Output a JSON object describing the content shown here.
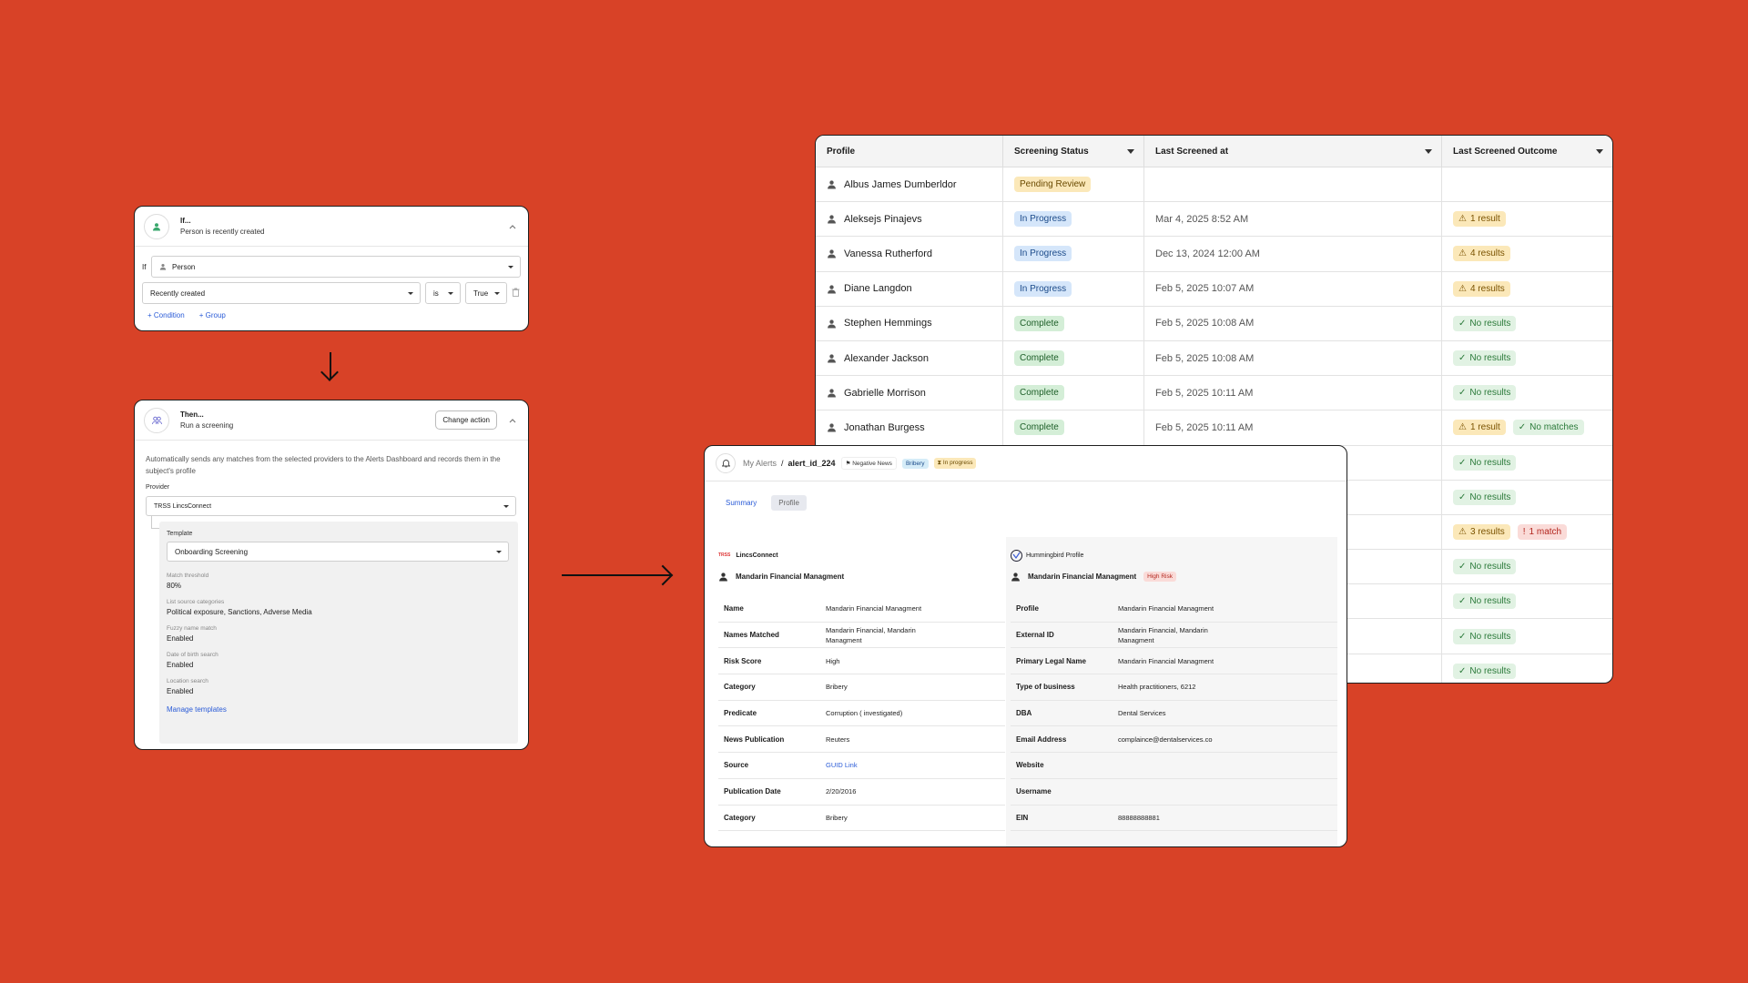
{
  "if_card": {
    "title": "If...",
    "subtitle": "Person is recently created",
    "if_label": "If",
    "subject_select": "Person",
    "condition_field": "Recently created",
    "operator": "is",
    "value": "True",
    "add_condition": "Condition",
    "add_group": "Group"
  },
  "then_card": {
    "title": "Then...",
    "subtitle": "Run a screening",
    "change_action": "Change action",
    "description": "Automatically sends any matches from the selected providers to the Alerts Dashboard and records them in the subject's profile",
    "provider_label": "Provider",
    "provider_value": "TRSS LincsConnect",
    "template_label": "Template",
    "template_value": "Onboarding Screening",
    "settings": [
      {
        "label": "Match threshold",
        "value": "80%"
      },
      {
        "label": "List source categories",
        "value": "Political exposure, Sanctions, Adverse Media"
      },
      {
        "label": "Fuzzy name match",
        "value": "Enabled"
      },
      {
        "label": "Date of birth search",
        "value": "Enabled"
      },
      {
        "label": "Location search",
        "value": "Enabled"
      }
    ],
    "manage_templates": "Manage templates"
  },
  "table": {
    "headers": [
      "Profile",
      "Screening Status",
      "Last Screened at",
      "Last Screened Outcome"
    ],
    "rows": [
      {
        "name": "Albus James Dumberldor",
        "status": "Pending Review",
        "date": "",
        "outcomes": []
      },
      {
        "name": "Aleksejs Pinajevs",
        "status": "In Progress",
        "date": "Mar 4, 2025 8:52 AM",
        "outcomes": [
          {
            "kind": "warn",
            "text": "1 result"
          }
        ]
      },
      {
        "name": "Vanessa Rutherford",
        "status": "In Progress",
        "date": "Dec 13, 2024 12:00 AM",
        "outcomes": [
          {
            "kind": "warn",
            "text": "4 results"
          }
        ]
      },
      {
        "name": "Diane Langdon",
        "status": "In Progress",
        "date": "Feb 5, 2025 10:07 AM",
        "outcomes": [
          {
            "kind": "warn",
            "text": "4 results"
          }
        ]
      },
      {
        "name": "Stephen Hemmings",
        "status": "Complete",
        "date": "Feb 5, 2025 10:08 AM",
        "outcomes": [
          {
            "kind": "ok",
            "text": "No results"
          }
        ]
      },
      {
        "name": "Alexander Jackson",
        "status": "Complete",
        "date": "Feb 5, 2025 10:08 AM",
        "outcomes": [
          {
            "kind": "ok",
            "text": "No results"
          }
        ]
      },
      {
        "name": "Gabrielle Morrison",
        "status": "Complete",
        "date": "Feb 5, 2025 10:11 AM",
        "outcomes": [
          {
            "kind": "ok",
            "text": "No results"
          }
        ]
      },
      {
        "name": "Jonathan Burgess",
        "status": "Complete",
        "date": "Feb 5, 2025 10:11 AM",
        "outcomes": [
          {
            "kind": "warn",
            "text": "1 result"
          },
          {
            "kind": "ok",
            "text": "No matches"
          }
        ]
      },
      {
        "name": "",
        "status": "",
        "date": "",
        "outcomes": [
          {
            "kind": "ok",
            "text": "No results"
          }
        ]
      },
      {
        "name": "",
        "status": "",
        "date": "",
        "outcomes": [
          {
            "kind": "ok",
            "text": "No results"
          }
        ]
      },
      {
        "name": "",
        "status": "",
        "date": "",
        "outcomes": [
          {
            "kind": "warn",
            "text": "3 results"
          },
          {
            "kind": "bad",
            "text": "1 match"
          }
        ]
      },
      {
        "name": "",
        "status": "",
        "date": "",
        "outcomes": [
          {
            "kind": "ok",
            "text": "No results"
          }
        ]
      },
      {
        "name": "",
        "status": "",
        "date": "",
        "outcomes": [
          {
            "kind": "ok",
            "text": "No results"
          }
        ]
      },
      {
        "name": "",
        "status": "",
        "date": "",
        "outcomes": [
          {
            "kind": "ok",
            "text": "No results"
          }
        ]
      },
      {
        "name": "",
        "status": "",
        "date": "",
        "outcomes": [
          {
            "kind": "ok",
            "text": "No results"
          }
        ]
      }
    ]
  },
  "alert": {
    "breadcrumb_root": "My Alerts",
    "breadcrumb_sep": "/",
    "alert_id": "alert_id_224",
    "tags": [
      "Negative News",
      "Bribery",
      "In progress"
    ],
    "tabs": [
      "Summary",
      "Profile"
    ],
    "left": {
      "provider": "LincsConnect",
      "provider_prefix": "TRSS",
      "entity": "Mandarin Financial Managment",
      "fields": [
        {
          "k": "Name",
          "v": "Mandarin Financial Managment"
        },
        {
          "k": "Names Matched",
          "v": "Mandarin Financial, Mandarin Managment"
        },
        {
          "k": "Risk Score",
          "v": "High"
        },
        {
          "k": "Category",
          "v": "Bribery"
        },
        {
          "k": "Predicate",
          "v": "Corruption ( investigated)"
        },
        {
          "k": "News Publication",
          "v": "Reuters"
        },
        {
          "k": "Source",
          "v": "GUID Link"
        },
        {
          "k": "Publication Date",
          "v": "2/20/2016"
        },
        {
          "k": "Category",
          "v": "Bribery"
        }
      ]
    },
    "right": {
      "provider": "Hummingbird Profile",
      "entity": "Mandarin Financial Managment",
      "risk_badge": "High Risk",
      "fields": [
        {
          "k": "Profile",
          "v": "Mandarin Financial Managment"
        },
        {
          "k": "External ID",
          "v": "Mandarin Financial, Mandarin Managment"
        },
        {
          "k": "Primary Legal Name",
          "v": "Mandarin Financial Managment"
        },
        {
          "k": "Type of business",
          "v": "Health practitioners,  6212"
        },
        {
          "k": "DBA",
          "v": "Dental Services"
        },
        {
          "k": "Email Address",
          "v": "complaince@dentalservices.co"
        },
        {
          "k": "Website",
          "v": ""
        },
        {
          "k": "Username",
          "v": ""
        },
        {
          "k": "EIN",
          "v": "88888888881"
        }
      ]
    }
  },
  "colors": {
    "background": "#D84227",
    "link": "#2a5bd7"
  },
  "icons": [
    "person-icon",
    "chevron-up-icon",
    "trash-icon",
    "plus-icon",
    "bell-icon",
    "warning-icon",
    "check-circle-icon",
    "alert-circle-icon",
    "hourglass-icon",
    "flag-icon"
  ]
}
